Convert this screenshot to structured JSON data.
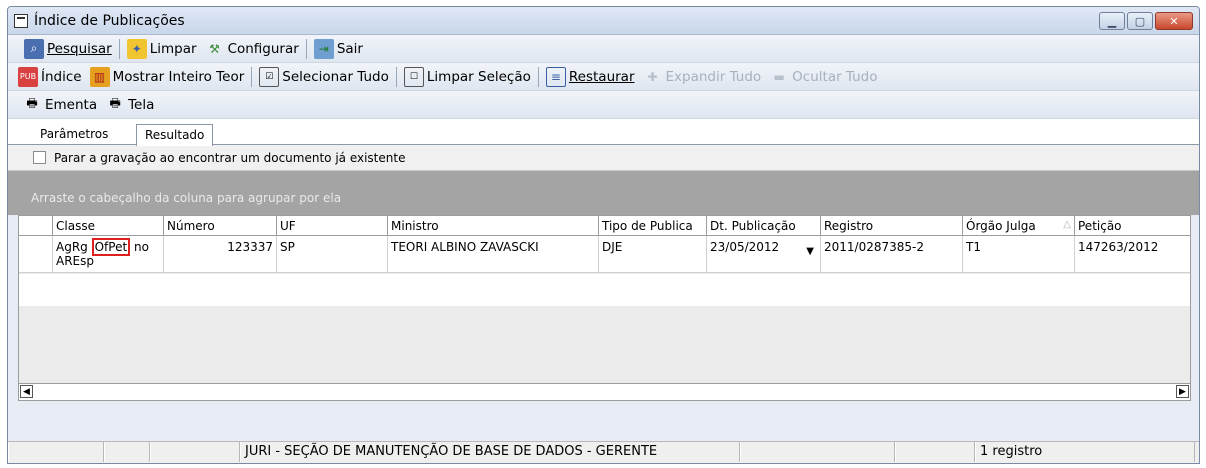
{
  "window": {
    "title": "Índice de Publicações"
  },
  "toolbar1": {
    "pesquisar": "Pesquisar",
    "limpar": "Limpar",
    "configurar": "Configurar",
    "sair": "Sair"
  },
  "toolbar2": {
    "indice": "Índice",
    "mostrar": "Mostrar Inteiro Teor",
    "selecionar": "Selecionar Tudo",
    "limpar_selecao": "Limpar Seleção",
    "restaurar": "Restaurar",
    "expandir": "Expandir Tudo",
    "ocultar": "Ocultar Tudo"
  },
  "toolbar3": {
    "ementa": "Ementa",
    "tela": "Tela"
  },
  "tabs": [
    {
      "label": "Parâmetros"
    },
    {
      "label": "Resultado"
    }
  ],
  "options": {
    "stop_label": "Parar a gravação ao encontrar um documento já existente"
  },
  "grid": {
    "group_hint": "Arraste o cabeçalho da coluna para agrupar por ela",
    "columns": [
      "Classe",
      "Número",
      "UF",
      "Ministro",
      "Tipo de Publica",
      "Dt. Publicação",
      "Registro",
      "Órgão Julga",
      "Petição"
    ],
    "row": {
      "classe_pre": "AgRg ",
      "classe_highlight": "OfPet",
      "classe_post": " no",
      "classe_line2": "AREsp",
      "numero": "123337",
      "uf": "SP",
      "ministro": "TEORI ALBINO ZAVASCKI",
      "tipo": "DJE",
      "data": "23/05/2012",
      "registro": "2011/0287385-2",
      "orgao": "T1",
      "peticao": "147263/2012"
    }
  },
  "status": {
    "user": "JURI - SEÇÃO DE MANUTENÇÃO DE BASE DE DADOS - GERENTE",
    "count": "1 registro"
  }
}
